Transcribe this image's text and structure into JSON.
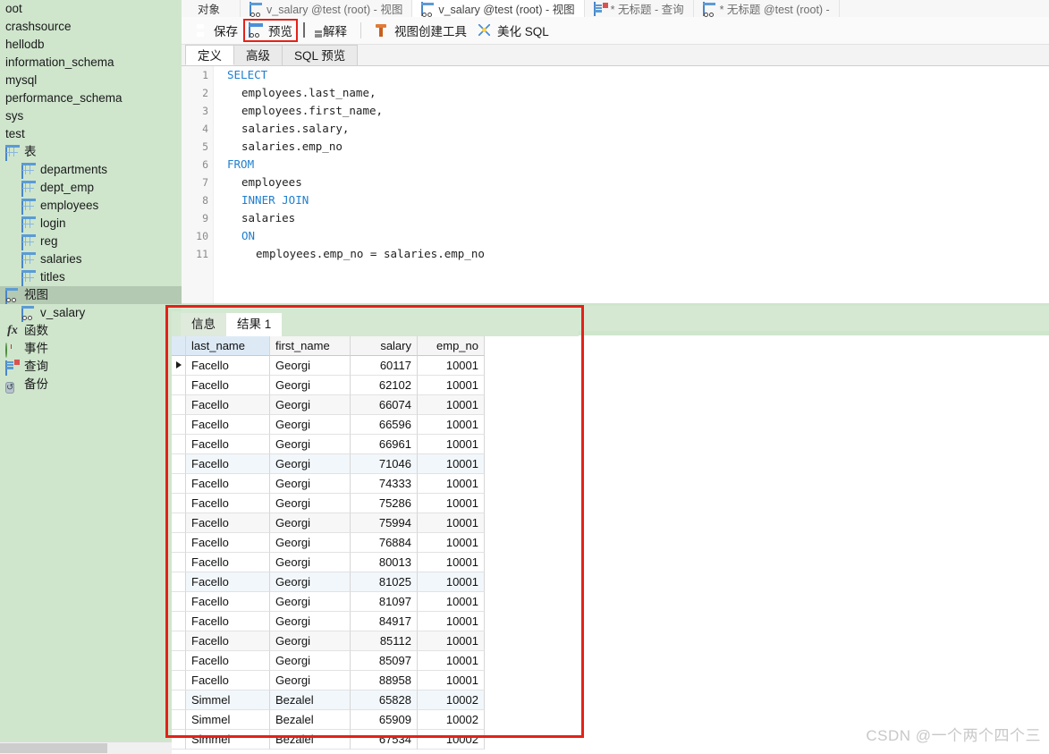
{
  "sidebar": {
    "items": [
      {
        "label": "oot",
        "icon": "none",
        "level": 0,
        "selected": false,
        "clipped": true
      },
      {
        "label": "crashsource",
        "icon": "none",
        "level": 0,
        "selected": false
      },
      {
        "label": "hellodb",
        "icon": "none",
        "level": 0,
        "selected": false
      },
      {
        "label": "information_schema",
        "icon": "none",
        "level": 0,
        "selected": false
      },
      {
        "label": "mysql",
        "icon": "none",
        "level": 0,
        "selected": false
      },
      {
        "label": "performance_schema",
        "icon": "none",
        "level": 0,
        "selected": false
      },
      {
        "label": "sys",
        "icon": "none",
        "level": 0,
        "selected": false
      },
      {
        "label": "test",
        "icon": "none",
        "level": 0,
        "selected": false
      },
      {
        "label": "表",
        "icon": "table-icon",
        "level": 1,
        "selected": false
      },
      {
        "label": "departments",
        "icon": "table-icon",
        "level": 2,
        "selected": false
      },
      {
        "label": "dept_emp",
        "icon": "table-icon",
        "level": 2,
        "selected": false
      },
      {
        "label": "employees",
        "icon": "table-icon",
        "level": 2,
        "selected": false
      },
      {
        "label": "login",
        "icon": "table-icon",
        "level": 2,
        "selected": false
      },
      {
        "label": "reg",
        "icon": "table-icon",
        "level": 2,
        "selected": false
      },
      {
        "label": "salaries",
        "icon": "table-icon",
        "level": 2,
        "selected": false
      },
      {
        "label": "titles",
        "icon": "table-icon",
        "level": 2,
        "selected": false
      },
      {
        "label": "视图",
        "icon": "view-icon",
        "level": 1,
        "selected": true
      },
      {
        "label": "v_salary",
        "icon": "view-icon",
        "level": 2,
        "selected": false
      },
      {
        "label": "函数",
        "icon": "function-icon",
        "level": 1,
        "selected": false
      },
      {
        "label": "事件",
        "icon": "event-clock-icon",
        "level": 1,
        "selected": false
      },
      {
        "label": "查询",
        "icon": "query-icon",
        "level": 1,
        "selected": false
      },
      {
        "label": "备份",
        "icon": "backup-icon",
        "level": 1,
        "selected": false
      }
    ]
  },
  "doctabs": [
    {
      "label": "对象",
      "icon": "none",
      "active": false
    },
    {
      "label": "v_salary @test (root) - 视图",
      "icon": "view-edit-icon",
      "active": false
    },
    {
      "label": "v_salary @test (root) - 视图",
      "icon": "view-icon",
      "active": true
    },
    {
      "label": "* 无标题 - 查询",
      "icon": "query-icon",
      "active": false
    },
    {
      "label": "* 无标题 @test (root) -",
      "icon": "view-edit-icon",
      "active": false
    }
  ],
  "toolbar": {
    "save_label": "保存",
    "preview_label": "预览",
    "explain_label": "解释",
    "view_builder_label": "视图创建工具",
    "beautify_label": "美化 SQL",
    "highlight_color": "#e32219"
  },
  "subtabs": [
    {
      "label": "定义",
      "active": true
    },
    {
      "label": "高级",
      "active": false
    },
    {
      "label": "SQL 预览",
      "active": false
    }
  ],
  "editor": {
    "line_numbers": [
      "1",
      "2",
      "3",
      "4",
      "5",
      "6",
      "7",
      "8",
      "9",
      "10",
      "11"
    ],
    "lines": [
      {
        "indent": 0,
        "parts": [
          {
            "t": "SELECT",
            "kw": true
          }
        ]
      },
      {
        "indent": 1,
        "parts": [
          {
            "t": "employees.last_name,",
            "kw": false
          }
        ]
      },
      {
        "indent": 1,
        "parts": [
          {
            "t": "employees.first_name,",
            "kw": false
          }
        ]
      },
      {
        "indent": 1,
        "parts": [
          {
            "t": "salaries.salary,",
            "kw": false
          }
        ]
      },
      {
        "indent": 1,
        "parts": [
          {
            "t": "salaries.emp_no",
            "kw": false
          }
        ]
      },
      {
        "indent": 0,
        "parts": [
          {
            "t": "FROM",
            "kw": true
          }
        ]
      },
      {
        "indent": 1,
        "parts": [
          {
            "t": "employees",
            "kw": false
          }
        ]
      },
      {
        "indent": 1,
        "parts": [
          {
            "t": "INNER JOIN",
            "kw": true
          }
        ]
      },
      {
        "indent": 1,
        "parts": [
          {
            "t": "salaries",
            "kw": false
          }
        ]
      },
      {
        "indent": 1,
        "parts": [
          {
            "t": "ON",
            "kw": true
          }
        ]
      },
      {
        "indent": 2,
        "parts": [
          {
            "t": "employees.emp_no = salaries.emp_no",
            "kw": false
          }
        ]
      }
    ]
  },
  "results": {
    "tabs": [
      {
        "label": "信息",
        "active": false
      },
      {
        "label": "结果 1",
        "active": true
      }
    ],
    "columns": [
      "last_name",
      "first_name",
      "salary",
      "emp_no"
    ],
    "rows": [
      [
        "Facello",
        "Georgi",
        "60117",
        "10001"
      ],
      [
        "Facello",
        "Georgi",
        "62102",
        "10001"
      ],
      [
        "Facello",
        "Georgi",
        "66074",
        "10001"
      ],
      [
        "Facello",
        "Georgi",
        "66596",
        "10001"
      ],
      [
        "Facello",
        "Georgi",
        "66961",
        "10001"
      ],
      [
        "Facello",
        "Georgi",
        "71046",
        "10001"
      ],
      [
        "Facello",
        "Georgi",
        "74333",
        "10001"
      ],
      [
        "Facello",
        "Georgi",
        "75286",
        "10001"
      ],
      [
        "Facello",
        "Georgi",
        "75994",
        "10001"
      ],
      [
        "Facello",
        "Georgi",
        "76884",
        "10001"
      ],
      [
        "Facello",
        "Georgi",
        "80013",
        "10001"
      ],
      [
        "Facello",
        "Georgi",
        "81025",
        "10001"
      ],
      [
        "Facello",
        "Georgi",
        "81097",
        "10001"
      ],
      [
        "Facello",
        "Georgi",
        "84917",
        "10001"
      ],
      [
        "Facello",
        "Georgi",
        "85112",
        "10001"
      ],
      [
        "Facello",
        "Georgi",
        "85097",
        "10001"
      ],
      [
        "Facello",
        "Georgi",
        "88958",
        "10001"
      ],
      [
        "Simmel",
        "Bezalel",
        "65828",
        "10002"
      ],
      [
        "Simmel",
        "Bezalel",
        "65909",
        "10002"
      ],
      [
        "Simmel",
        "Bezalel",
        "67534",
        "10002"
      ]
    ],
    "current_row_index": 0
  },
  "watermark": "CSDN @一个两个四个三"
}
